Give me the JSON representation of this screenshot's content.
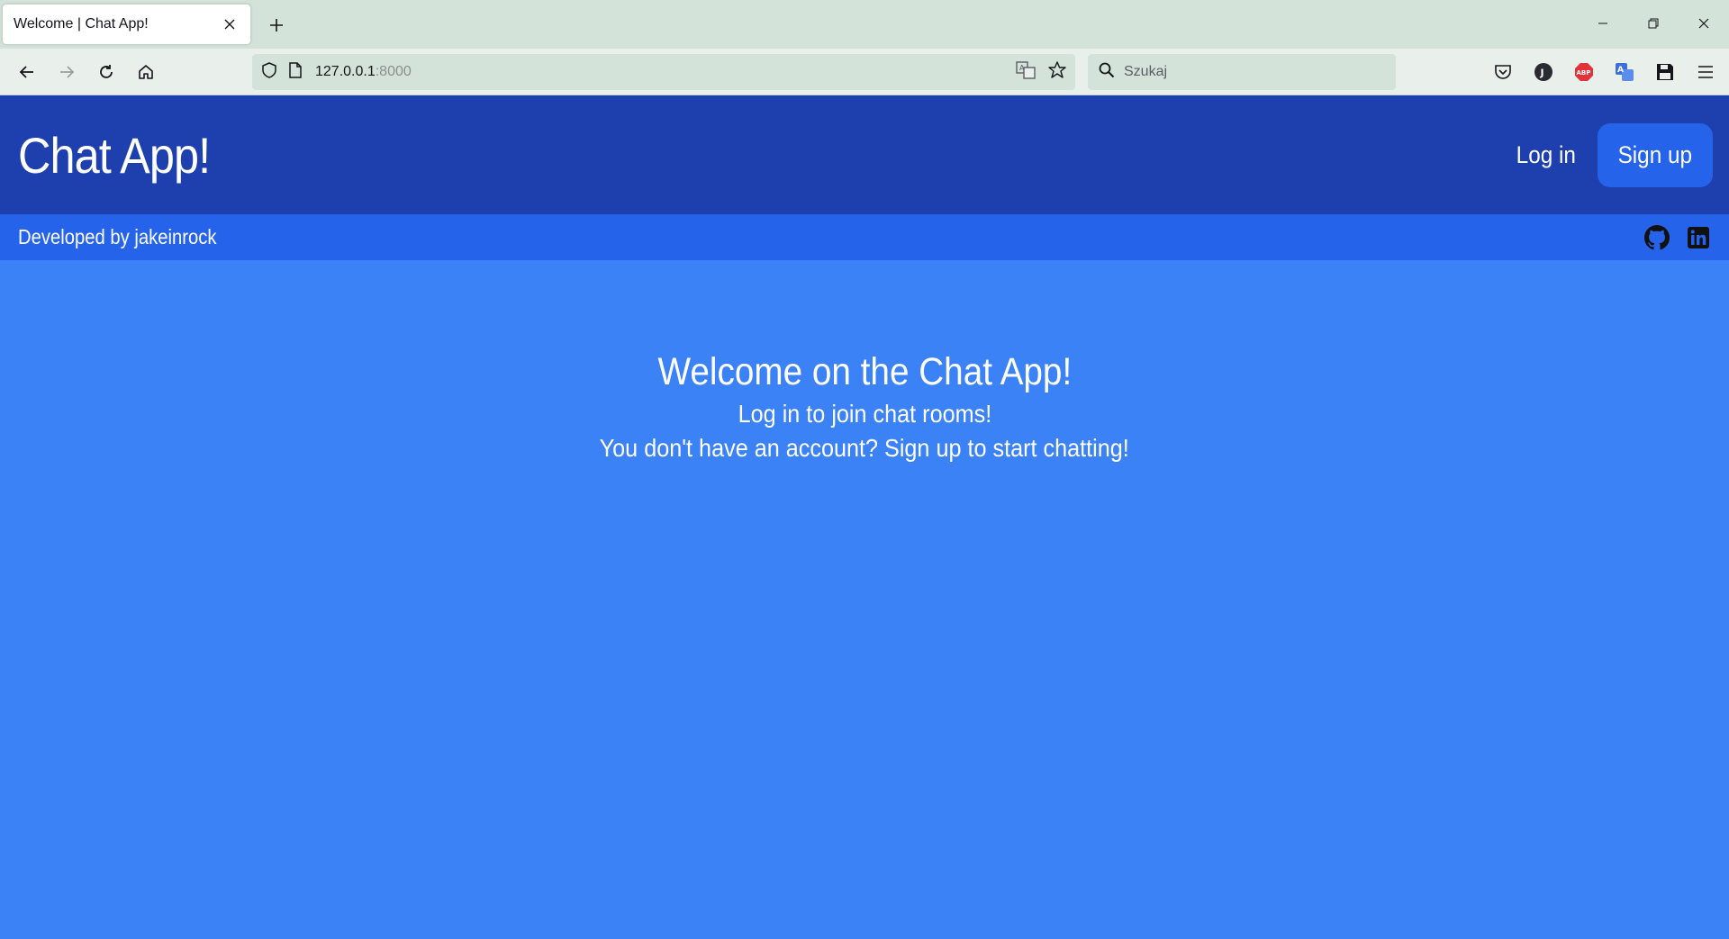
{
  "browser": {
    "tab_title": "Welcome | Chat App!",
    "url_host": "127.0.0.1",
    "url_port": ":8000",
    "search_placeholder": "Szukaj"
  },
  "header": {
    "title": "Chat App!",
    "login_label": "Log in",
    "signup_label": "Sign up"
  },
  "subbar": {
    "credit": "Developed by jakeinrock",
    "icons": [
      "github-icon",
      "linkedin-icon"
    ]
  },
  "main": {
    "heading": "Welcome on the Chat App!",
    "line1": "Log in to join chat rooms!",
    "line2": "You don't have an account? Sign up to start chatting!"
  },
  "colors": {
    "header_bg": "#1e40af",
    "subbar_bg": "#2563eb",
    "page_bg": "#3b82f6",
    "signup_bg": "#2563eb"
  }
}
